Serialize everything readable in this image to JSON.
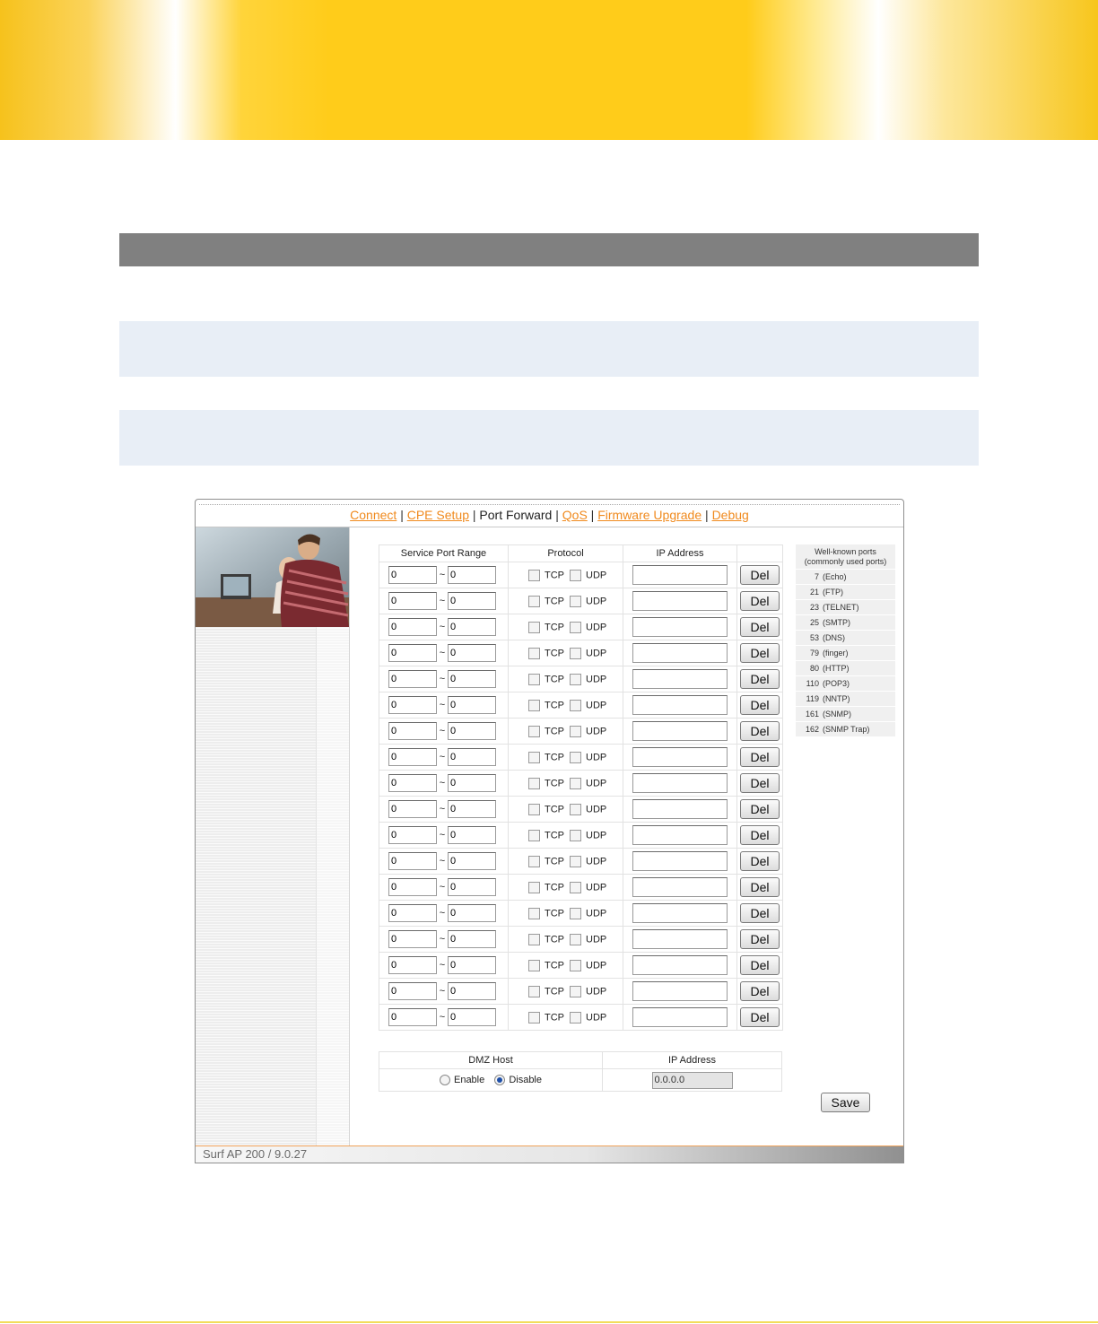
{
  "nav": {
    "items": [
      {
        "label": "Connect",
        "link": true
      },
      {
        "label": "CPE Setup",
        "link": true
      },
      {
        "label": "Port Forward",
        "link": false
      },
      {
        "label": "QoS",
        "link": true
      },
      {
        "label": "Firmware Upgrade",
        "link": true
      },
      {
        "label": "Debug",
        "link": true
      }
    ],
    "separator": "|"
  },
  "port_forward": {
    "headers": {
      "range": "Service Port Range",
      "protocol": "Protocol",
      "ip": "IP Address",
      "action": ""
    },
    "tilde": "~",
    "tcp_label": "TCP",
    "udp_label": "UDP",
    "del_label": "Del",
    "rows": [
      {
        "start": "0",
        "end": "0",
        "tcp": false,
        "udp": false,
        "ip": ""
      },
      {
        "start": "0",
        "end": "0",
        "tcp": false,
        "udp": false,
        "ip": ""
      },
      {
        "start": "0",
        "end": "0",
        "tcp": false,
        "udp": false,
        "ip": ""
      },
      {
        "start": "0",
        "end": "0",
        "tcp": false,
        "udp": false,
        "ip": ""
      },
      {
        "start": "0",
        "end": "0",
        "tcp": false,
        "udp": false,
        "ip": ""
      },
      {
        "start": "0",
        "end": "0",
        "tcp": false,
        "udp": false,
        "ip": ""
      },
      {
        "start": "0",
        "end": "0",
        "tcp": false,
        "udp": false,
        "ip": ""
      },
      {
        "start": "0",
        "end": "0",
        "tcp": false,
        "udp": false,
        "ip": ""
      },
      {
        "start": "0",
        "end": "0",
        "tcp": false,
        "udp": false,
        "ip": ""
      },
      {
        "start": "0",
        "end": "0",
        "tcp": false,
        "udp": false,
        "ip": ""
      },
      {
        "start": "0",
        "end": "0",
        "tcp": false,
        "udp": false,
        "ip": ""
      },
      {
        "start": "0",
        "end": "0",
        "tcp": false,
        "udp": false,
        "ip": ""
      },
      {
        "start": "0",
        "end": "0",
        "tcp": false,
        "udp": false,
        "ip": ""
      },
      {
        "start": "0",
        "end": "0",
        "tcp": false,
        "udp": false,
        "ip": ""
      },
      {
        "start": "0",
        "end": "0",
        "tcp": false,
        "udp": false,
        "ip": ""
      },
      {
        "start": "0",
        "end": "0",
        "tcp": false,
        "udp": false,
        "ip": ""
      },
      {
        "start": "0",
        "end": "0",
        "tcp": false,
        "udp": false,
        "ip": ""
      },
      {
        "start": "0",
        "end": "0",
        "tcp": false,
        "udp": false,
        "ip": ""
      }
    ]
  },
  "dmz": {
    "host_header": "DMZ Host",
    "ip_header": "IP Address",
    "enable_label": "Enable",
    "disable_label": "Disable",
    "selected": "disable",
    "ip_value": "0.0.0.0"
  },
  "well_known": {
    "title_line1": "Well-known ports",
    "title_line2": "(commonly used ports)",
    "ports": [
      {
        "num": "7",
        "name": "(Echo)"
      },
      {
        "num": "21",
        "name": "(FTP)"
      },
      {
        "num": "23",
        "name": "(TELNET)"
      },
      {
        "num": "25",
        "name": "(SMTP)"
      },
      {
        "num": "53",
        "name": "(DNS)"
      },
      {
        "num": "79",
        "name": "(finger)"
      },
      {
        "num": "80",
        "name": "(HTTP)"
      },
      {
        "num": "110",
        "name": "(POP3)"
      },
      {
        "num": "119",
        "name": "(NNTP)"
      },
      {
        "num": "161",
        "name": "(SNMP)"
      },
      {
        "num": "162",
        "name": "(SNMP Trap)"
      }
    ]
  },
  "save_label": "Save",
  "footer_text": "Surf AP 200 / 9.0.27",
  "colors": {
    "link": "#f08a1e",
    "banner": "#ffcc1a",
    "header_bar": "#808080",
    "band": "#e8eef6"
  }
}
